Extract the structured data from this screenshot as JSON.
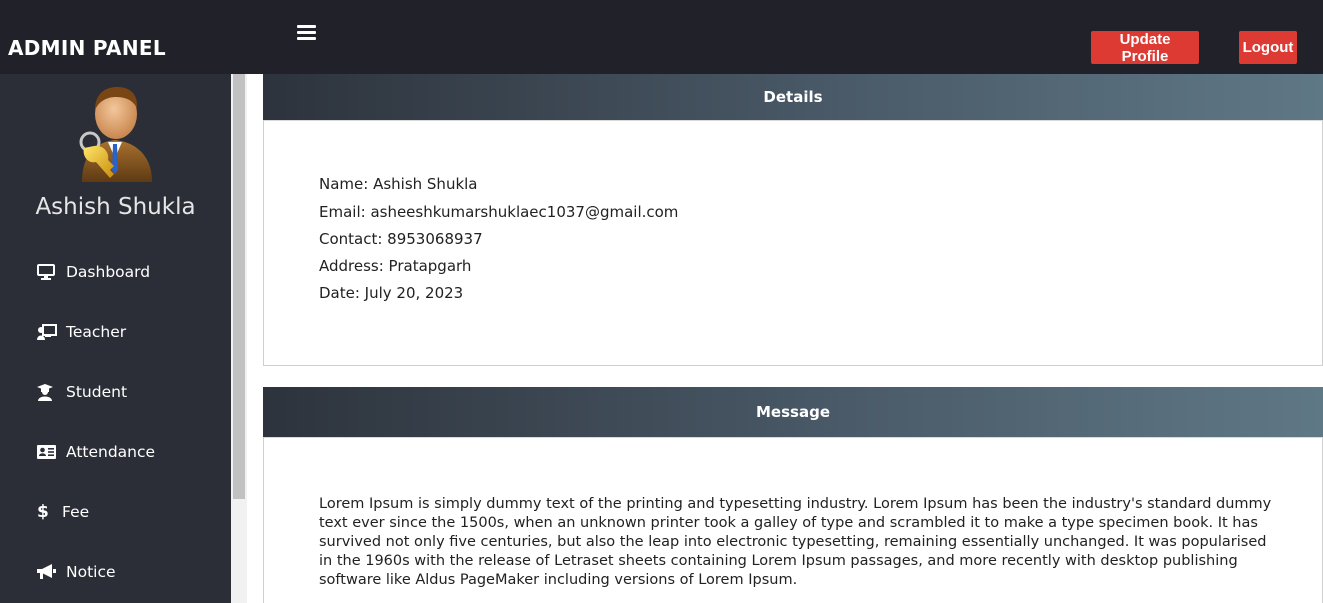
{
  "header": {
    "brand": "ADMIN PANEL",
    "update_label": "Update Profile",
    "logout_label": "Logout",
    "accent_color": "#dc3a33"
  },
  "sidebar": {
    "username": "Ashish Shukla",
    "avatar_icon": "admin-avatar-with-key",
    "items": [
      {
        "label": "Dashboard",
        "icon": "monitor-icon"
      },
      {
        "label": "Teacher",
        "icon": "teacher-board-icon"
      },
      {
        "label": "Student",
        "icon": "graduate-icon"
      },
      {
        "label": "Attendance",
        "icon": "id-card-icon"
      },
      {
        "label": "Fee",
        "icon": "dollar-icon"
      },
      {
        "label": "Notice",
        "icon": "megaphone-icon"
      }
    ]
  },
  "details": {
    "title": "Details",
    "name": "Name: Ashish Shukla",
    "email": "Email: asheeshkumarshuklaec1037@gmail.com",
    "contact": "Contact: 8953068937",
    "address": "Address: Pratapgarh",
    "date": "Date: July 20, 2023"
  },
  "message": {
    "title": "Message",
    "text": "Lorem Ipsum is simply dummy text of the printing and typesetting industry. Lorem Ipsum has been the industry's standard dummy text ever since the 1500s, when an unknown printer took a galley of type and scrambled it to make a type specimen book. It has survived not only five centuries, but also the leap into electronic typesetting, remaining essentially unchanged. It was popularised in the 1960s with the release of Letraset sheets containing Lorem Ipsum passages, and more recently with desktop publishing software like Aldus PageMaker including versions of Lorem Ipsum."
  }
}
